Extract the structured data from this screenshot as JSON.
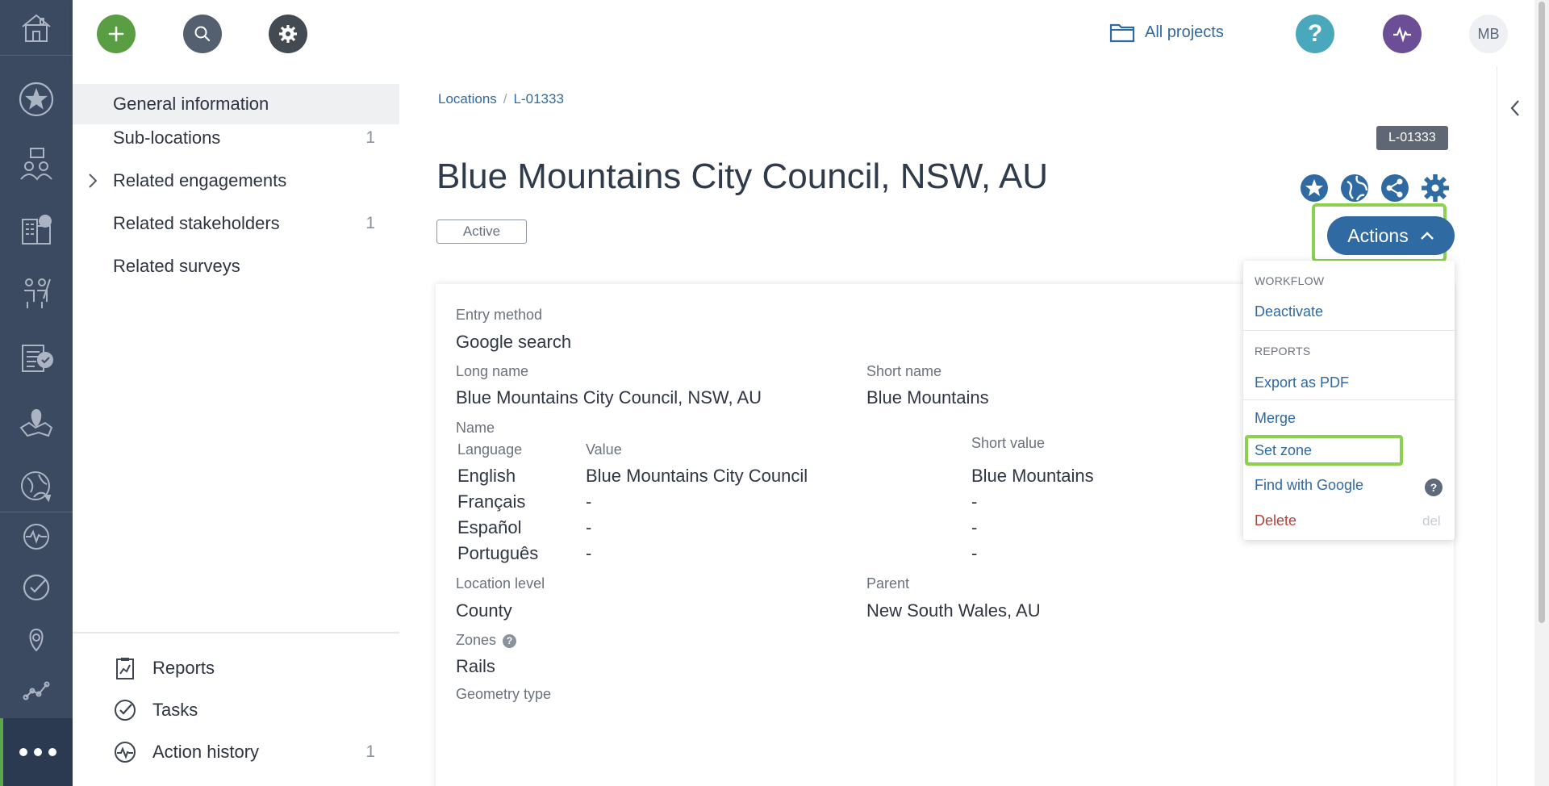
{
  "header": {
    "add_icon": "plus-icon",
    "search_icon": "search-icon",
    "settings_icon": "gear-icon",
    "projects_label": "All projects",
    "help_icon": "question-icon",
    "activity_icon": "pulse-icon",
    "avatar_initials": "MB",
    "colors": {
      "add": "#5a9e43",
      "search": "#546070",
      "settings": "#444a52",
      "help": "#4aa8bd",
      "activity": "#6b4e95"
    }
  },
  "rail": {
    "items": [
      "home-icon",
      "star-icon",
      "engagements-icon",
      "buildings-icon",
      "stakeholders-icon",
      "surveys-icon",
      "locations-icon",
      "globe-icon",
      "activity-icon",
      "tasks-icon",
      "pin-icon",
      "analytics-icon"
    ],
    "more_icon": "more-dots-icon"
  },
  "subnav": {
    "items": [
      {
        "label": "General information",
        "count": ""
      },
      {
        "label": "Sub-locations",
        "count": "1"
      },
      {
        "label": "Related engagements",
        "count": ""
      },
      {
        "label": "Related stakeholders",
        "count": "1"
      },
      {
        "label": "Related surveys",
        "count": ""
      }
    ],
    "bottom": [
      {
        "label": "Reports",
        "count": ""
      },
      {
        "label": "Tasks",
        "count": ""
      },
      {
        "label": "Action history",
        "count": "1"
      }
    ]
  },
  "breadcrumb": {
    "root": "Locations",
    "separator": "/",
    "current": "L-01333"
  },
  "record": {
    "id": "L-01333",
    "title": "Blue Mountains City Council, NSW, AU",
    "status": "Active",
    "actions_label": "Actions"
  },
  "fields": {
    "entry_method_label": "Entry method",
    "entry_method_value": "Google search",
    "long_name_label": "Long name",
    "long_name_value": "Blue Mountains City Council, NSW, AU",
    "short_name_label": "Short name",
    "short_name_value": "Blue Mountains",
    "name_label": "Name",
    "name_table": {
      "headers": [
        "Language",
        "Value",
        "Short value"
      ],
      "rows": [
        [
          "English",
          "Blue Mountains City Council",
          "Blue Mountains"
        ],
        [
          "Français",
          "-",
          "-"
        ],
        [
          "Español",
          "-",
          "-"
        ],
        [
          "Português",
          "-",
          "-"
        ]
      ]
    },
    "location_level_label": "Location level",
    "location_level_value": "County",
    "parent_label": "Parent",
    "parent_value": "New South Wales, AU",
    "zones_label": "Zones",
    "zones_value": "Rails",
    "geometry_label": "Geometry type"
  },
  "actions_menu": {
    "workflow_header": "WORKFLOW",
    "deactivate": "Deactivate",
    "reports_header": "REPORTS",
    "export_pdf": "Export as PDF",
    "merge": "Merge",
    "set_zone": "Set zone",
    "find_google": "Find with Google",
    "delete": "Delete",
    "delete_shortcut": "del"
  },
  "highlight_color": "#8bd04e",
  "accent_color": "#2f6aa3"
}
